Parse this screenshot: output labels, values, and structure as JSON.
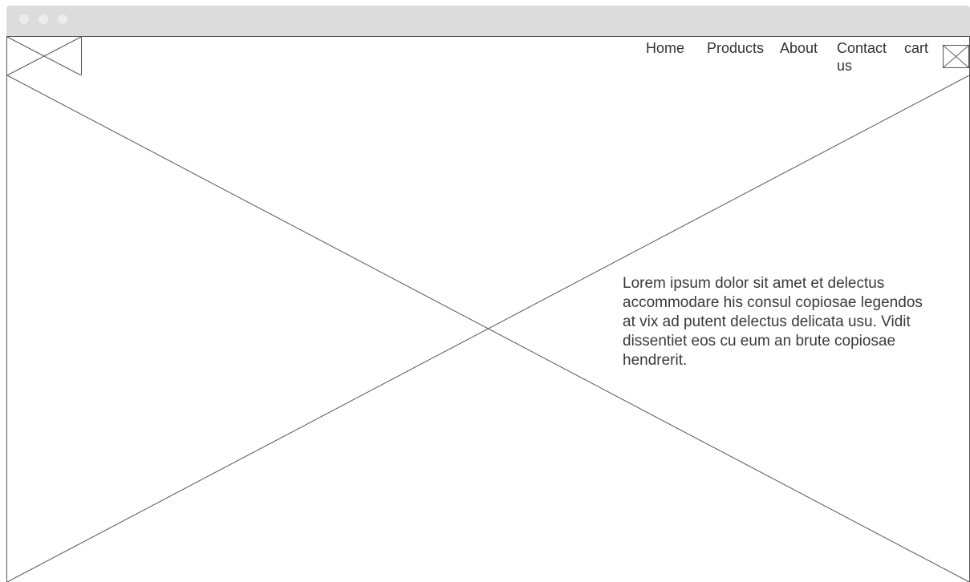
{
  "nav": {
    "items": [
      {
        "label": "Home"
      },
      {
        "label": "Products"
      },
      {
        "label": "About"
      },
      {
        "label": "Contact us"
      },
      {
        "label": "cart"
      }
    ],
    "cart_icon": "image-placeholder-icon",
    "logo_icon": "image-placeholder-icon"
  },
  "hero": {
    "image_icon": "image-placeholder-icon",
    "text": "Lorem ipsum dolor sit amet et delectus accommodare his consul copiosae legendos at vix ad putent delectus delicata usu. Vidit dissentiet eos cu eum an brute copiosae hendrerit."
  },
  "colors": {
    "titlebar": "#dcdcdc",
    "window_dots": "#ececec",
    "stroke": "#555555",
    "text": "#333333"
  }
}
